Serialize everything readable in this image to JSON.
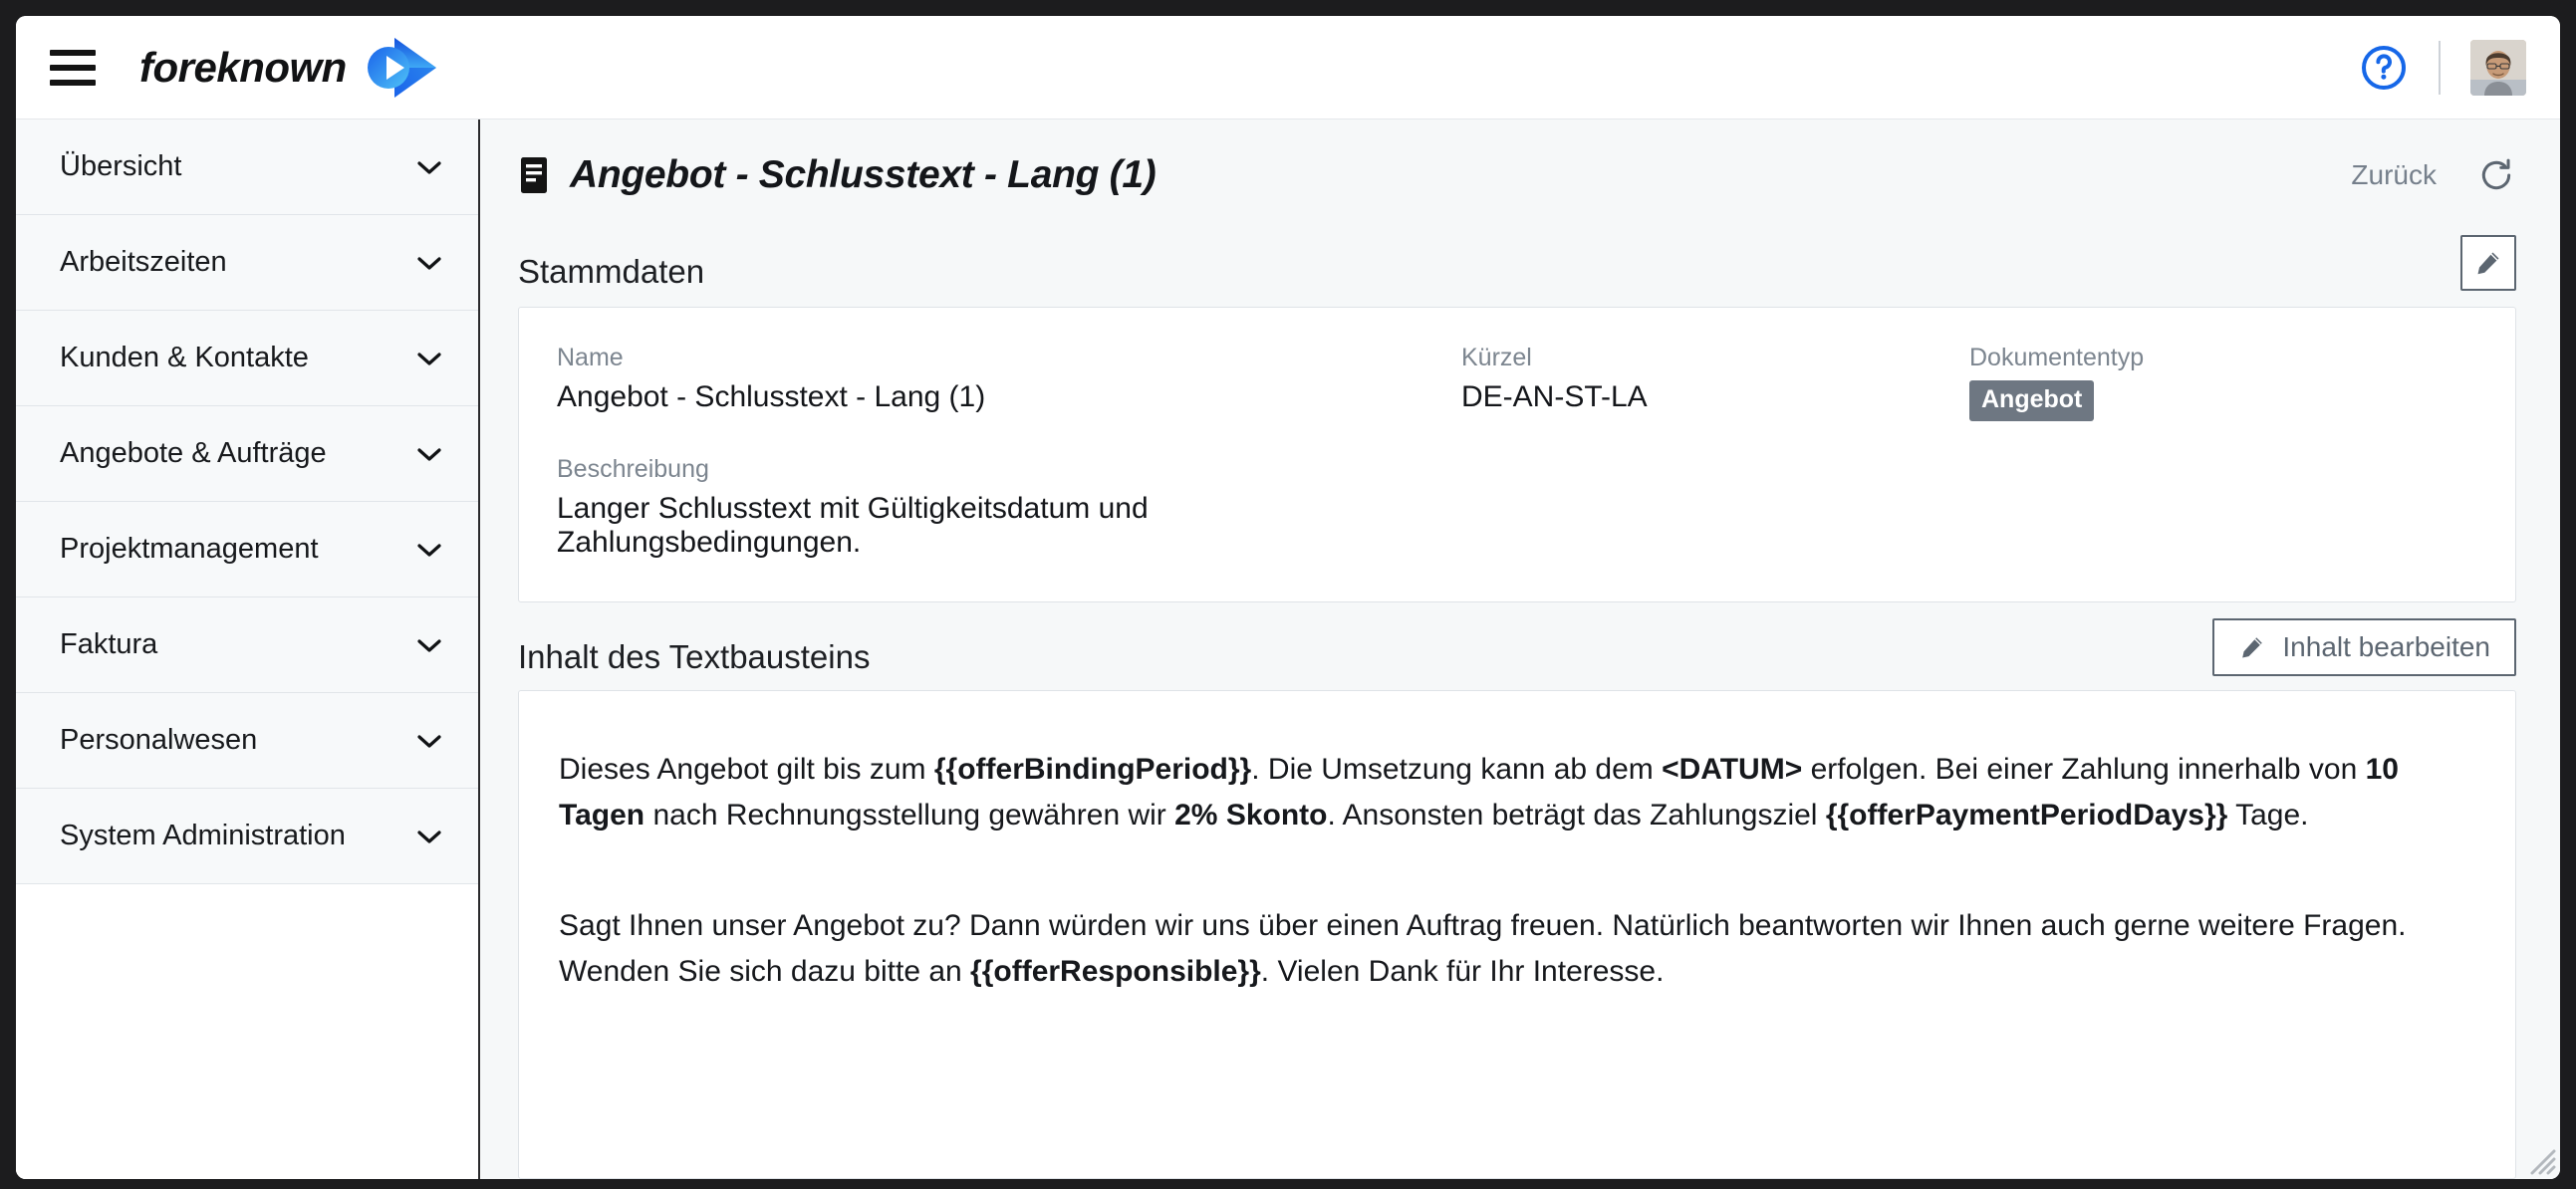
{
  "app": {
    "brand_name": "foreknown",
    "menu_icon": "hamburger-icon",
    "help_icon": "help-circle-icon",
    "avatar_icon": "user-avatar"
  },
  "sidebar": {
    "items": [
      {
        "label": "Übersicht",
        "icon": "chevron-down-icon"
      },
      {
        "label": "Arbeitszeiten",
        "icon": "chevron-down-icon"
      },
      {
        "label": "Kunden & Kontakte",
        "icon": "chevron-down-icon"
      },
      {
        "label": "Angebote & Aufträge",
        "icon": "chevron-down-icon"
      },
      {
        "label": "Projektmanagement",
        "icon": "chevron-down-icon"
      },
      {
        "label": "Faktura",
        "icon": "chevron-down-icon"
      },
      {
        "label": "Personalwesen",
        "icon": "chevron-down-icon"
      },
      {
        "label": "System Administration",
        "icon": "chevron-down-icon"
      }
    ]
  },
  "page": {
    "title": "Angebot - Schlusstext - Lang (1)",
    "title_icon": "document-text-icon",
    "back_label": "Zurück",
    "refresh_icon": "refresh-icon"
  },
  "stammdaten": {
    "section_title": "Stammdaten",
    "edit_icon": "pencil-icon",
    "fields": {
      "name_label": "Name",
      "name_value": "Angebot - Schlusstext - Lang (1)",
      "kuerzel_label": "Kürzel",
      "kuerzel_value": "DE-AN-ST-LA",
      "dokumententyp_label": "Dokumententyp",
      "dokumententyp_value": "Angebot",
      "beschreibung_label": "Beschreibung",
      "beschreibung_value": "Langer Schlusstext mit Gültigkeitsdatum und Zahlungsbedingungen."
    }
  },
  "inhalt": {
    "section_title": "Inhalt des Textbausteins",
    "edit_button_label": "Inhalt bearbeiten",
    "edit_button_icon": "pencil-icon",
    "paragraphs": [
      {
        "parts": [
          {
            "text": "Dieses Angebot gilt bis zum ",
            "bold": false
          },
          {
            "text": "{{offerBindingPeriod}}",
            "bold": true
          },
          {
            "text": ". Die Umsetzung kann ab dem ",
            "bold": false
          },
          {
            "text": "<DATUM>",
            "bold": true
          },
          {
            "text": " erfolgen. Bei einer Zahlung innerhalb von ",
            "bold": false
          },
          {
            "text": "10 Tagen",
            "bold": true
          },
          {
            "text": " nach Rechnungsstellung gewähren wir ",
            "bold": false
          },
          {
            "text": "2% Skonto",
            "bold": true
          },
          {
            "text": ". Ansonsten beträgt das Zahlungsziel ",
            "bold": false
          },
          {
            "text": "{{offerPaymentPeriodDays}}",
            "bold": true
          },
          {
            "text": " Tage.",
            "bold": false
          }
        ]
      },
      {
        "parts": [
          {
            "text": "Sagt Ihnen unser Angebot zu? Dann würden wir uns über einen Auftrag freuen. Natürlich beantworten wir Ihnen auch gerne weitere Fragen. Wenden Sie sich dazu bitte an ",
            "bold": false
          },
          {
            "text": "{{offerResponsible}}",
            "bold": true
          },
          {
            "text": ". Vielen Dank für Ihr Interesse.",
            "bold": false
          }
        ]
      }
    ]
  },
  "colors": {
    "brand_blue": "#1667e8",
    "badge_gray": "#6e7782",
    "muted_text": "#76808c",
    "page_bg": "#f6f8f9",
    "sidebar_item_bg": "#f7f9fa"
  }
}
